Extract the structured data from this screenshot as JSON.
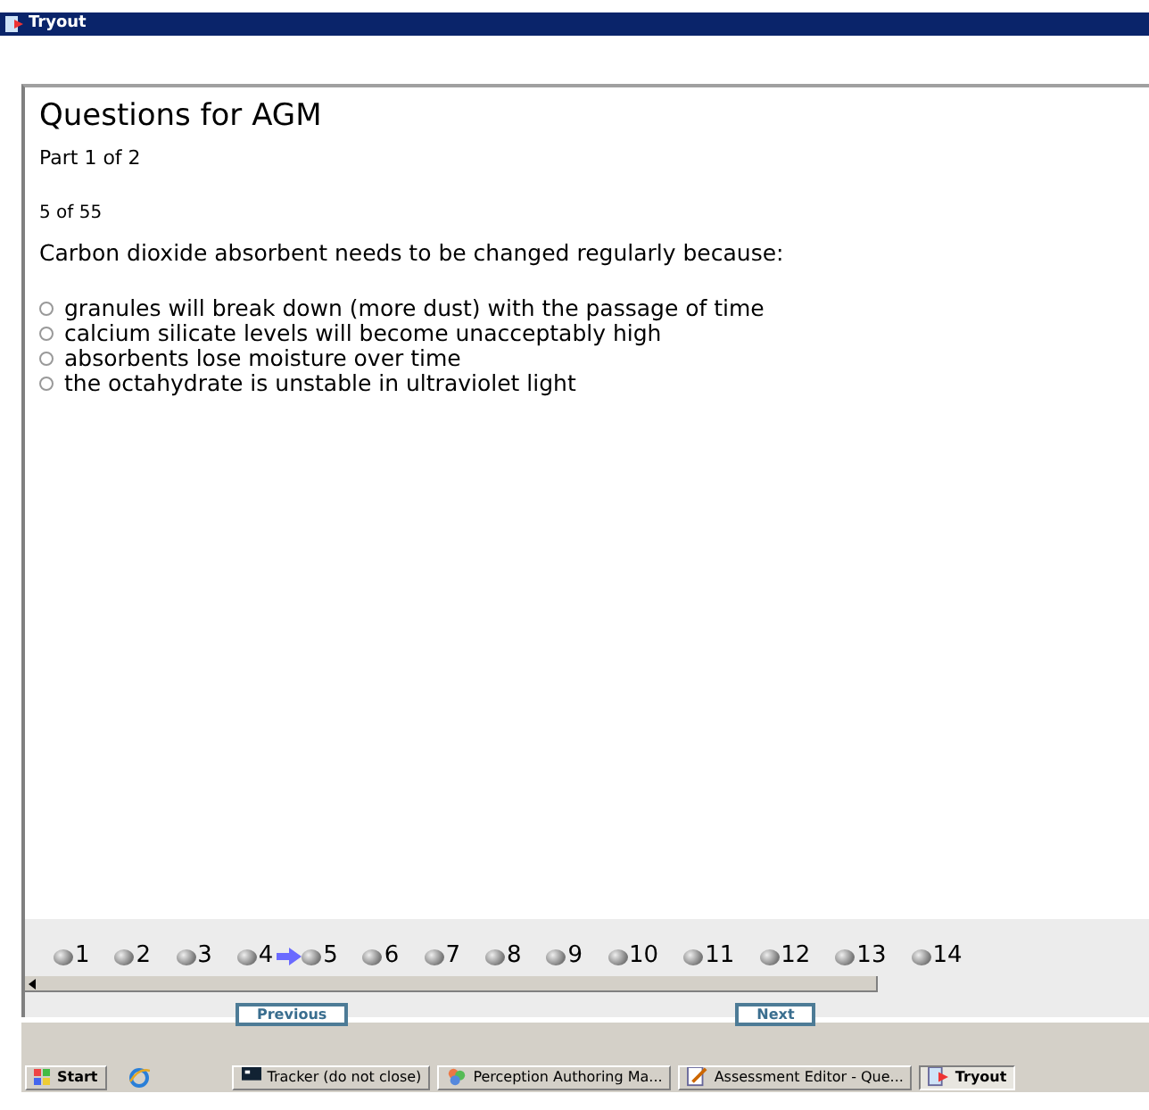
{
  "window": {
    "title": "Tryout"
  },
  "assessment": {
    "title": "Questions for AGM",
    "part": "Part 1 of 2",
    "progress": "5 of 55",
    "question": "Carbon dioxide absorbent needs to be changed regularly because:"
  },
  "choices": [
    {
      "label": "granules will break down (more dust) with the passage of time",
      "selected": false
    },
    {
      "label": "calcium silicate levels will become unacceptably high",
      "selected": false
    },
    {
      "label": "absorbents lose moisture over time",
      "selected": false
    },
    {
      "label": "the octahydrate is unstable in ultraviolet light",
      "selected": false
    }
  ],
  "question_nav": [
    {
      "label": "1",
      "current": false
    },
    {
      "label": "2",
      "current": false
    },
    {
      "label": "3",
      "current": false
    },
    {
      "label": "4",
      "current": false
    },
    {
      "label": "5",
      "current": true
    },
    {
      "label": "6",
      "current": false
    },
    {
      "label": "7",
      "current": false
    },
    {
      "label": "8",
      "current": false
    },
    {
      "label": "9",
      "current": false
    },
    {
      "label": "10",
      "current": false
    },
    {
      "label": "11",
      "current": false
    },
    {
      "label": "12",
      "current": false
    },
    {
      "label": "13",
      "current": false
    },
    {
      "label": "14",
      "current": false
    }
  ],
  "buttons": [
    {
      "label": "Previous"
    },
    {
      "label": "Next"
    }
  ],
  "taskbar": {
    "start": "Start",
    "tasks": [
      {
        "kind": "console",
        "label": "Tracker (do not close)",
        "active": false
      },
      {
        "kind": "authoring",
        "label": "Perception Authoring Ma...",
        "active": false
      },
      {
        "kind": "editor",
        "label": "Assessment Editor - Que...",
        "active": false
      },
      {
        "kind": "tryout",
        "label": "Tryout",
        "active": true
      }
    ]
  }
}
